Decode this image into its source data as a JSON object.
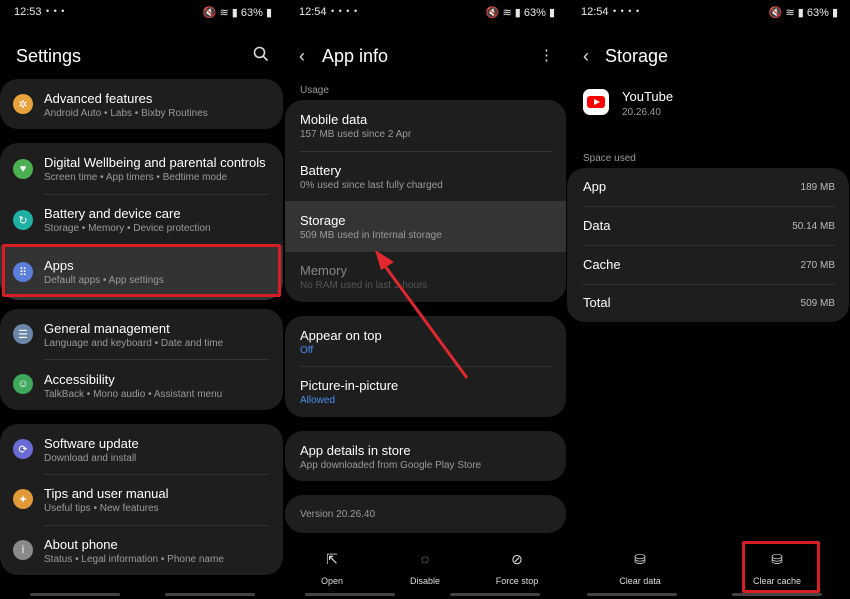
{
  "panel1": {
    "status": {
      "time": "12:53",
      "left_icons": "• • •",
      "right": "63%"
    },
    "title": "Settings",
    "groups": [
      [
        {
          "title": "Advanced features",
          "sub": "Android Auto  •  Labs  •  Bixby Routines",
          "icon": "gear-plus-icon",
          "color": "#e8a23c"
        }
      ],
      [
        {
          "title": "Digital Wellbeing and parental controls",
          "sub": "Screen time  •  App timers  •  Bedtime mode",
          "icon": "heart-icon",
          "color": "#4caf50"
        },
        {
          "title": "Battery and device care",
          "sub": "Storage  •  Memory  •  Device protection",
          "icon": "refresh-icon",
          "color": "#1fb0a3"
        },
        {
          "title": "Apps",
          "sub": "Default apps  •  App settings",
          "icon": "grid-icon",
          "color": "#5b7fd8"
        }
      ],
      [
        {
          "title": "General management",
          "sub": "Language and keyboard  •  Date and time",
          "icon": "sliders-icon",
          "color": "#6a86a8"
        },
        {
          "title": "Accessibility",
          "sub": "TalkBack  •  Mono audio  •  Assistant menu",
          "icon": "person-icon",
          "color": "#3fa85a"
        }
      ],
      [
        {
          "title": "Software update",
          "sub": "Download and install",
          "icon": "update-icon",
          "color": "#6b6bd6"
        },
        {
          "title": "Tips and user manual",
          "sub": "Useful tips  •  New features",
          "icon": "bulb-icon",
          "color": "#e29a38"
        },
        {
          "title": "About phone",
          "sub": "Status  •  Legal information  •  Phone name",
          "icon": "info-icon",
          "color": "#8a8a8a"
        }
      ]
    ]
  },
  "panel2": {
    "status": {
      "time": "12:54",
      "left_icons": "• • • •",
      "right": "63%"
    },
    "title": "App info",
    "section": "Usage",
    "usage": [
      {
        "title": "Mobile data",
        "sub": "157 MB used since 2 Apr"
      },
      {
        "title": "Battery",
        "sub": "0% used since last fully charged"
      },
      {
        "title": "Storage",
        "sub": "509 MB used in Internal storage"
      },
      {
        "title": "Memory",
        "sub": "No RAM used in last 3 hours"
      }
    ],
    "perms": [
      {
        "title": "Appear on top",
        "sub": "Off"
      },
      {
        "title": "Picture-in-picture",
        "sub": "Allowed"
      }
    ],
    "store": {
      "title": "App details in store",
      "sub": "App downloaded from Google Play Store"
    },
    "version": "Version 20.26.40",
    "buttons": [
      "Open",
      "Disable",
      "Force stop"
    ]
  },
  "panel3": {
    "status": {
      "time": "12:54",
      "left_icons": "• • • •",
      "right": "63%"
    },
    "title": "Storage",
    "app_name": "YouTube",
    "app_version": "20.26.40",
    "section": "Space used",
    "rows": [
      {
        "label": "App",
        "value": "189 MB"
      },
      {
        "label": "Data",
        "value": "50.14 MB"
      },
      {
        "label": "Cache",
        "value": "270 MB"
      },
      {
        "label": "Total",
        "value": "509 MB"
      }
    ],
    "buttons": [
      "Clear data",
      "Clear cache"
    ]
  },
  "colors": {
    "highlight": "#d81e24",
    "arrow": "#e0282e",
    "youtube": "#ff0000",
    "link_blue": "#4b8ff0"
  }
}
